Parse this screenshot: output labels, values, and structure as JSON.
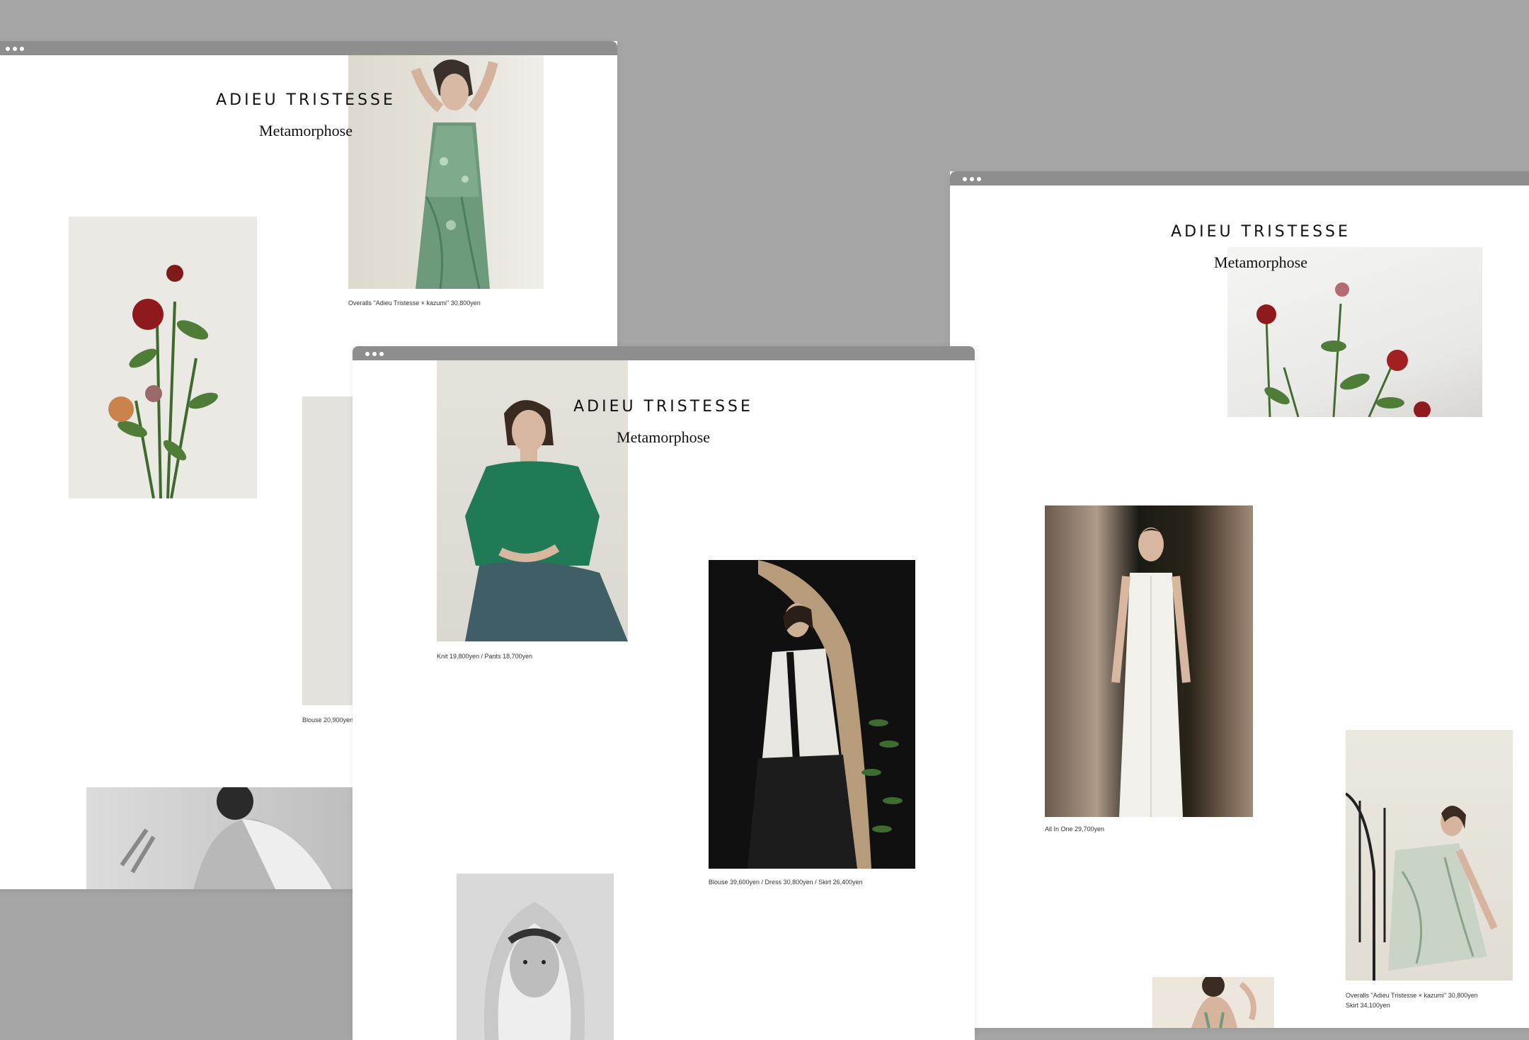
{
  "brand": "ADIEU TRISTESSE",
  "subtitle": "Metamorphose",
  "colors": {
    "background": "#a6a6a6",
    "window_bar": "#8e8e8e",
    "page": "#ffffff",
    "text": "#111111"
  },
  "windows": {
    "left": {
      "captions": {
        "overalls": "Overalls \"Adieu Tristesse × kazumi\" 30,800yen",
        "blouse": "Blouse 20,900yen"
      }
    },
    "center": {
      "captions": {
        "knit": "Knit 19,800yen / Pants 18,700yen",
        "blouse_dress": "Blouse 39,600yen / Dress 30,800yen / Skirt 26,400yen"
      }
    },
    "right": {
      "captions": {
        "all_in_one": "All In One 29,700yen",
        "overalls_line1": "Overalls \"Adieu Tristesse × kazumi\" 30,800yen",
        "overalls_line2": "Skirt 34,100yen"
      }
    }
  }
}
